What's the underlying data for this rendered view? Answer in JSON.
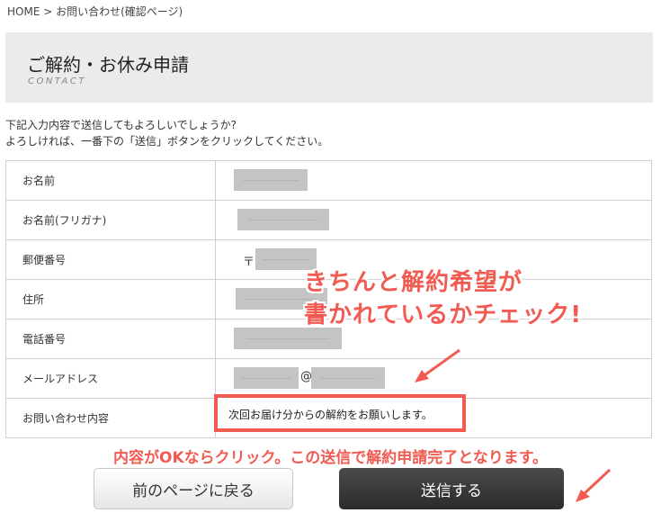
{
  "breadcrumb": "HOME > お問い合わせ(確認ページ)",
  "page": {
    "title": "ご解約・お休み申請",
    "subtitle": "CONTACT"
  },
  "intro": {
    "line1": "下記入力内容で送信してもよろしいでしょうか?",
    "line2": "よろしければ、一番下の「送信」ボタンをクリックしてください。"
  },
  "form": {
    "name_label": "お名前",
    "kana_label": "お名前(フリガナ)",
    "postal_label": "郵便番号",
    "postal_prefix": "〒",
    "address_label": "住所",
    "phone_label": "電話番号",
    "email_label": "メールアドレス",
    "email_at": "@",
    "inquiry_label": "お問い合わせ内容",
    "inquiry_value": "次回お届け分からの解約をお願いします。"
  },
  "annotations": {
    "note_line1": "きちんと解約希望が",
    "note_line2": "書かれているかチェック!",
    "note_bottom": "内容がOKならクリック。この送信で解約申請完了となります。",
    "color": "#f15b52"
  },
  "buttons": {
    "back": "前のページに戻る",
    "send": "送信する"
  }
}
